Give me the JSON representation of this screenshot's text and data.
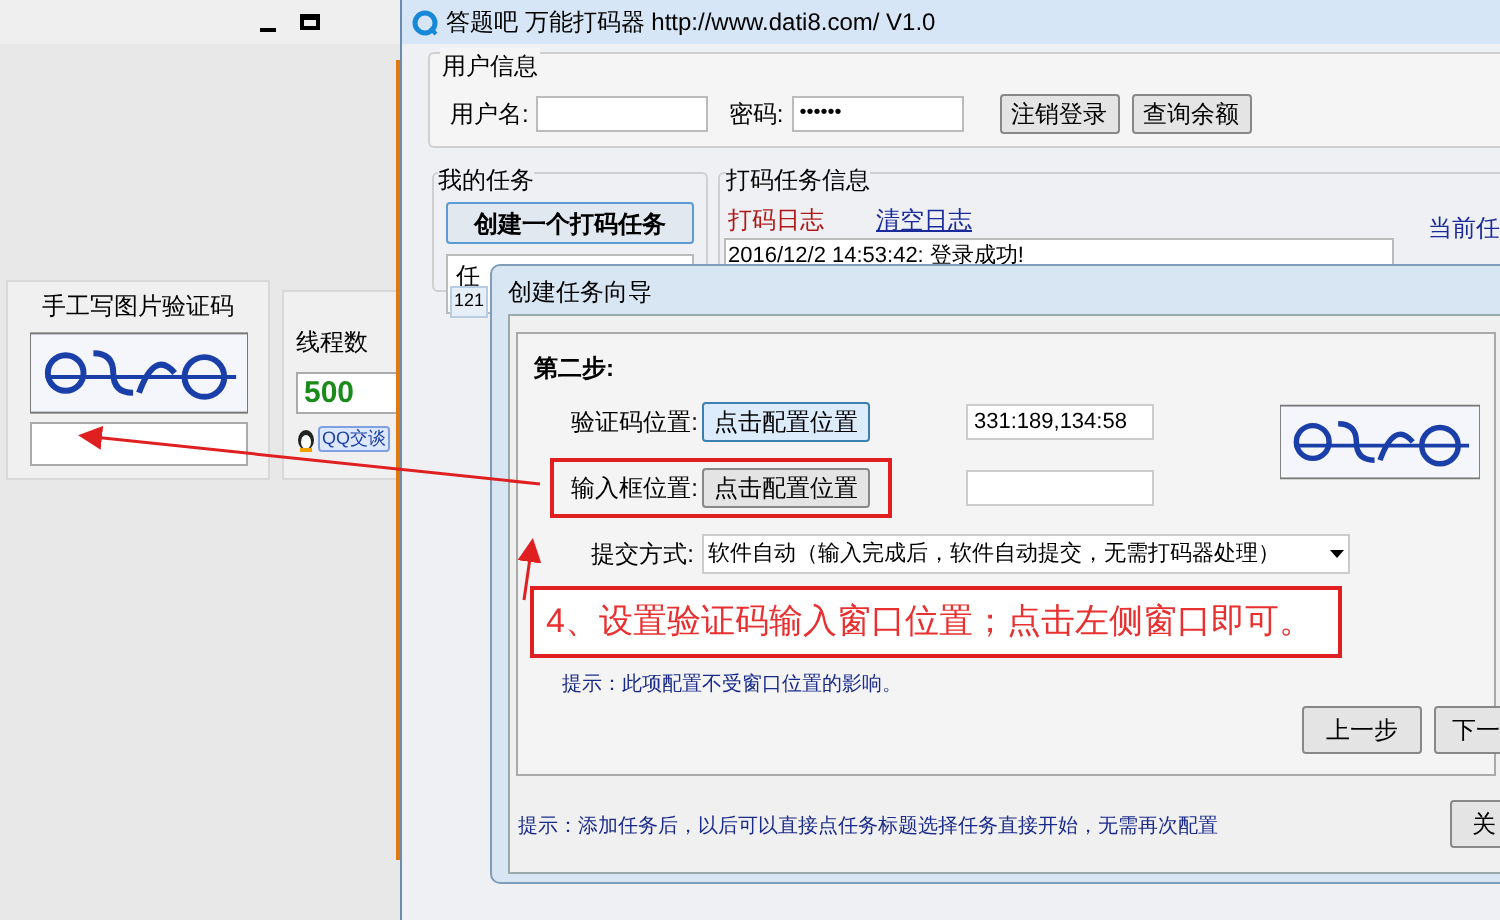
{
  "left_window": {
    "panel_title": "手工写图片验证码",
    "thread_label": "线程数",
    "thread_value": "500",
    "chat_badge": "QQ交谈"
  },
  "main_window": {
    "title": "答题吧 万能打码器 http://www.dati8.com/ V1.0",
    "user_info": {
      "title": "用户信息",
      "username_label": "用户名:",
      "password_label": "密码:",
      "password_value": "••••••",
      "buttons": [
        "注销登录",
        "查询余额"
      ]
    },
    "my_tasks": {
      "title": "我的任务",
      "create_button": "创建一个打码任务",
      "list_header": "任",
      "rows": [
        "121"
      ]
    },
    "task_info": {
      "title": "打码任务信息",
      "tabs": [
        {
          "label": "打码日志",
          "selected": true
        },
        {
          "label": "清空日志",
          "selected": false
        }
      ],
      "right_label": "当前任",
      "log": [
        "2016/12/2 14:53:42: 登录成功!"
      ]
    }
  },
  "dialog": {
    "title": "创建任务向导",
    "step": "第二步:",
    "rows": [
      {
        "label": "验证码位置:",
        "button": "点击配置位置",
        "value": "331:189,134:58",
        "highlighted": false
      },
      {
        "label": "输入框位置:",
        "button": "点击配置位置",
        "value": "",
        "highlighted": true
      }
    ],
    "submit_label": "提交方式:",
    "submit_value": "软件自动（输入完成后，软件自动提交，无需打码器处理）",
    "annotation": "4、设置验证码输入窗口位置；点击左侧窗口即可。",
    "hint": "提示：此项配置不受窗口位置的影响。",
    "buttons": [
      "上一步",
      "下一"
    ],
    "footer_hint": "提示：添加任务后，以后可以直接点任务标题选择任务直接开始，无需再次配置",
    "close_button": "关"
  }
}
